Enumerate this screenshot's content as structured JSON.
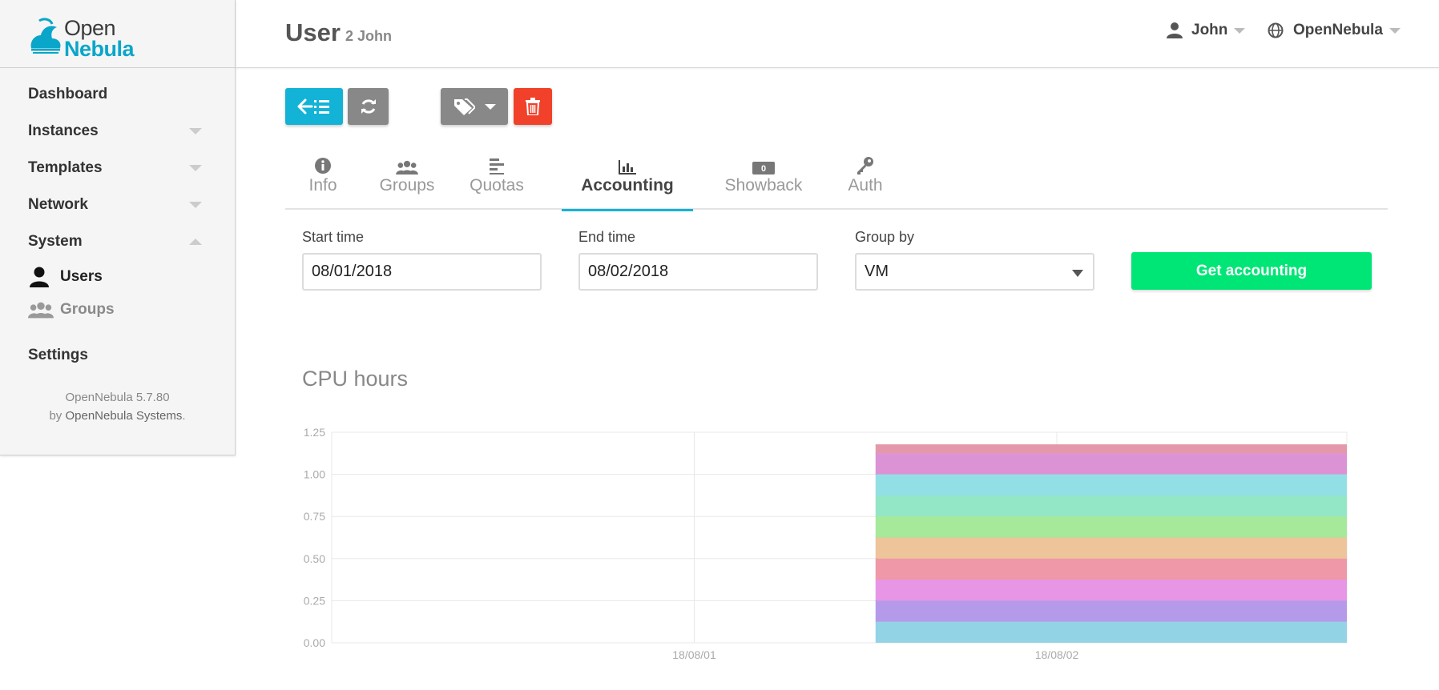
{
  "logo": {
    "line1": "Open",
    "line2": "Nebula"
  },
  "sidebar": {
    "items": [
      {
        "label": "Dashboard",
        "has_caret": false
      },
      {
        "label": "Instances",
        "has_caret": true
      },
      {
        "label": "Templates",
        "has_caret": true
      },
      {
        "label": "Network",
        "has_caret": true
      },
      {
        "label": "System",
        "has_caret": true,
        "expanded": true
      }
    ],
    "subitems": [
      {
        "label": "Users",
        "icon": "user-icon",
        "active": true
      },
      {
        "label": "Groups",
        "icon": "users-group-icon",
        "active": false
      }
    ],
    "settings_label": "Settings",
    "footer": {
      "version": "OpenNebula 5.7.80",
      "by": "by",
      "company": "OpenNebula Systems",
      "period": "."
    }
  },
  "header": {
    "title": "User",
    "subtitle": "2 John",
    "user_menu": "John",
    "zone_menu": "OpenNebula"
  },
  "toolbar": {
    "back_icon": "arrow-left-list-icon",
    "refresh_icon": "refresh-icon",
    "labels_icon": "tags-icon",
    "delete_icon": "trash-icon"
  },
  "tabs": [
    {
      "label": "Info",
      "icon": "info-circle-icon",
      "active": false
    },
    {
      "label": "Groups",
      "icon": "users-group-icon",
      "active": false
    },
    {
      "label": "Quotas",
      "icon": "align-left-icon",
      "active": false
    },
    {
      "label": "Accounting",
      "icon": "bar-chart-icon",
      "active": true
    },
    {
      "label": "Showback",
      "icon": "money-bill-icon",
      "active": false
    },
    {
      "label": "Auth",
      "icon": "key-icon",
      "active": false
    }
  ],
  "form": {
    "start_label": "Start time",
    "start_value": "08/01/2018",
    "end_label": "End time",
    "end_value": "08/02/2018",
    "group_label": "Group by",
    "group_value": "VM",
    "submit_label": "Get accounting"
  },
  "chart_data": {
    "type": "area",
    "title": "CPU hours",
    "x": [
      "18/08/01",
      "18/08/02"
    ],
    "ylim": [
      0,
      1.25
    ],
    "yticks": [
      "0.00",
      "0.25",
      "0.50",
      "0.75",
      "1.00",
      "1.25"
    ],
    "stacked": true,
    "x_range_days": [
      0,
      2.8
    ],
    "area_start_day": 1.5,
    "series": [
      {
        "values": [
          0,
          0.125
        ],
        "color": "#93d3e6"
      },
      {
        "values": [
          0,
          0.125
        ],
        "color": "#b69aea"
      },
      {
        "values": [
          0,
          0.125
        ],
        "color": "#e796e6"
      },
      {
        "values": [
          0,
          0.125
        ],
        "color": "#ee98a8"
      },
      {
        "values": [
          0,
          0.125
        ],
        "color": "#eec49a"
      },
      {
        "values": [
          0,
          0.125
        ],
        "color": "#a6e99a"
      },
      {
        "values": [
          0,
          0.125
        ],
        "color": "#93e7c6"
      },
      {
        "values": [
          0,
          0.125
        ],
        "color": "#93dfe6"
      },
      {
        "values": [
          0,
          0.125
        ],
        "color": "#dc93d6"
      },
      {
        "values": [
          0,
          0.05
        ],
        "color": "#e499aa"
      }
    ]
  }
}
